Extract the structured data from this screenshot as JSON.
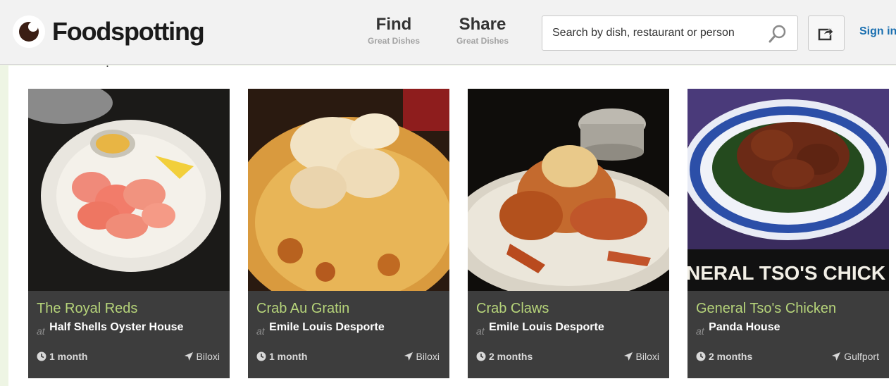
{
  "header": {
    "logo_text": "Foodspotting",
    "nav": [
      {
        "label": "Find",
        "sub": "Great Dishes"
      },
      {
        "label": "Share",
        "sub": "Great Dishes"
      }
    ],
    "search": {
      "placeholder": "Search by dish, restaurant or person"
    },
    "signin_label": "Sign in"
  },
  "colors": {
    "dish_name": "#b6d47a",
    "card_bg": "#3d3d3d",
    "signin": "#1a6fb0",
    "page_bg": "#eef5e4"
  },
  "cards": [
    {
      "dish": "The Royal Reds",
      "at": "at",
      "place": "Half Shells Oyster House",
      "time": "1 month",
      "city": "Biloxi"
    },
    {
      "dish": "Crab Au Gratin",
      "at": "at",
      "place": "Emile Louis Desporte",
      "time": "1 month",
      "city": "Biloxi"
    },
    {
      "dish": "Crab Claws",
      "at": "at",
      "place": "Emile Louis Desporte",
      "time": "2 months",
      "city": "Biloxi"
    },
    {
      "dish": "General Tso's Chicken",
      "at": "at",
      "place": "Panda House",
      "time": "2 months",
      "city": "Gulfport",
      "photo_text": "NERAL TSO'S CHICK"
    }
  ]
}
